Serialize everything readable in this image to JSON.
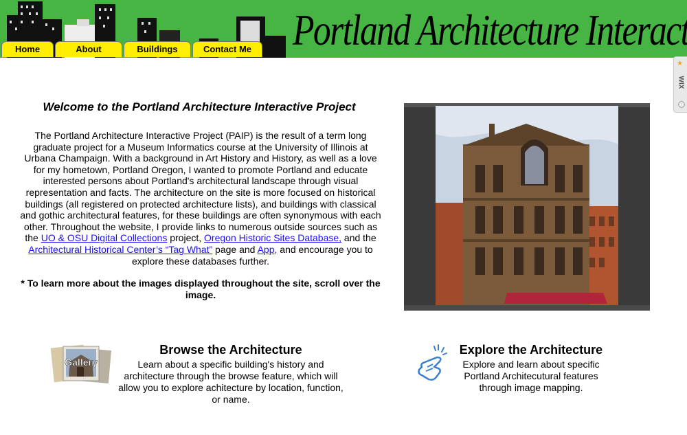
{
  "header": {
    "site_title": "Portland Architecture Interactive",
    "brand_color": "#46b543"
  },
  "nav": {
    "tabs": [
      {
        "label": "Home"
      },
      {
        "label": "About"
      },
      {
        "label": "Buildings"
      },
      {
        "label": "Contact Me"
      }
    ],
    "tab_color": "#ffee00"
  },
  "wix_badge": {
    "label": "WIX"
  },
  "main": {
    "title": "Welcome to the Portland Architecture Interactive Project",
    "intro_text": "The Portland Architecture Interactive Project (PAIP) is the result of a term long graduate project for a  Museum Informatics course at the University of Illinois at Urbana Champaign. With a background in Art History and History, as well as a love for my hometown, Portland Oregon, I wanted to promote Portland and educate interested persons about Portland's architectural landscape through visual representation and facts. The architecture on the site is more focused on historical buildings (all registered on protected architecture lists), and buildings with classical and gothic architectural features, for these buildings are often synonymous with each other. Throughout the website, I provide links to numerous outside sources such as the",
    "link_uo": "UO & OSU Digital Collections",
    "text_project": " project, ",
    "link_oregon": "Oregon Historic Sites Database,",
    "text_and_the": " and the ",
    "link_ahc": "Architectural Historical Center’s “Tag What”",
    "text_page_and": " page and ",
    "link_app": "App,",
    "text_end": " and encourage you to explore these databases further.",
    "note": "* To learn more about the images displayed throughout the site, scroll over the image."
  },
  "features": {
    "gallery_icon_label": "Gallery",
    "browse_title": "Browse the Architecture",
    "browse_text": "Learn about a specific building's history and architecture through the browse feature, which will allow you to explore achitecture by location, function, or name.",
    "explore_title": "Explore the Architecture",
    "explore_text": "Explore and learn about specific Portland Architecutural features through image mapping."
  }
}
